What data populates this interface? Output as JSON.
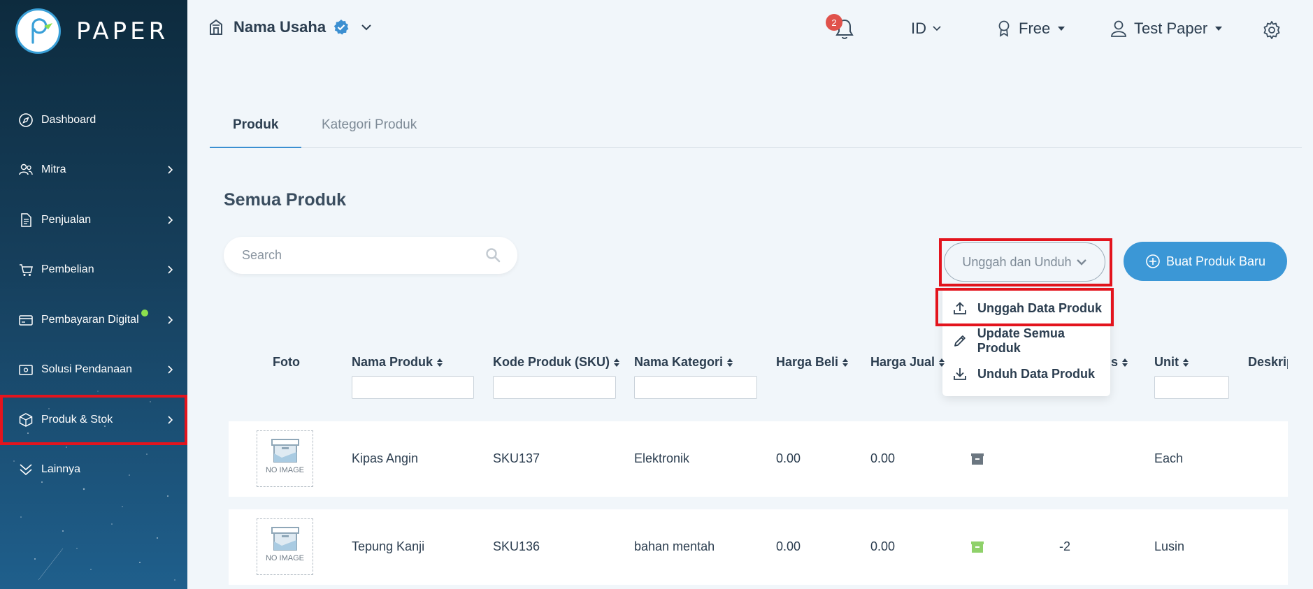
{
  "sidebar": {
    "brand": "PAPER",
    "items": [
      {
        "label": "Dashboard"
      },
      {
        "label": "Mitra"
      },
      {
        "label": "Penjualan"
      },
      {
        "label": "Pembelian"
      },
      {
        "label": "Pembayaran Digital"
      },
      {
        "label": "Solusi Pendanaan"
      },
      {
        "label": "Produk & Stok"
      },
      {
        "label": "Lainnya"
      }
    ]
  },
  "header": {
    "business_name": "Nama Usaha",
    "notification_count": "2",
    "language": "ID",
    "plan": "Free",
    "user": "Test Paper"
  },
  "tabs": [
    {
      "label": "Produk"
    },
    {
      "label": "Kategori Produk"
    }
  ],
  "main": {
    "title": "Semua Produk",
    "search_placeholder": "Search",
    "upload_download_label": "Unggah dan Unduh",
    "new_product_label": "Buat Produk Baru",
    "dropdown": [
      {
        "label": "Unggah Data Produk"
      },
      {
        "label": "Update Semua Produk"
      },
      {
        "label": "Unduh Data Produk"
      }
    ]
  },
  "table": {
    "columns": [
      "Foto",
      "Nama Produk",
      "Kode Produk (SKU)",
      "Nama Kategori",
      "Harga Beli",
      "Harga Jual",
      "s",
      "Unit",
      "Deskrip"
    ],
    "no_image_label": "NO IMAGE",
    "rows": [
      {
        "name": "Kipas Angin",
        "sku": "SKU137",
        "category": "Elektronik",
        "buy": "0.00",
        "sell": "0.00",
        "stock": "",
        "unit": "Each",
        "status_color": "#6b7680"
      },
      {
        "name": "Tepung Kanji",
        "sku": "SKU136",
        "category": "bahan mentah",
        "buy": "0.00",
        "sell": "0.00",
        "stock": "-2",
        "unit": "Lusin",
        "status_color": "#8fd16a"
      }
    ]
  },
  "colors": {
    "accent": "#3b97d6",
    "highlight": "#e3141d",
    "notification": "#e0524b",
    "online": "#8be04e"
  }
}
